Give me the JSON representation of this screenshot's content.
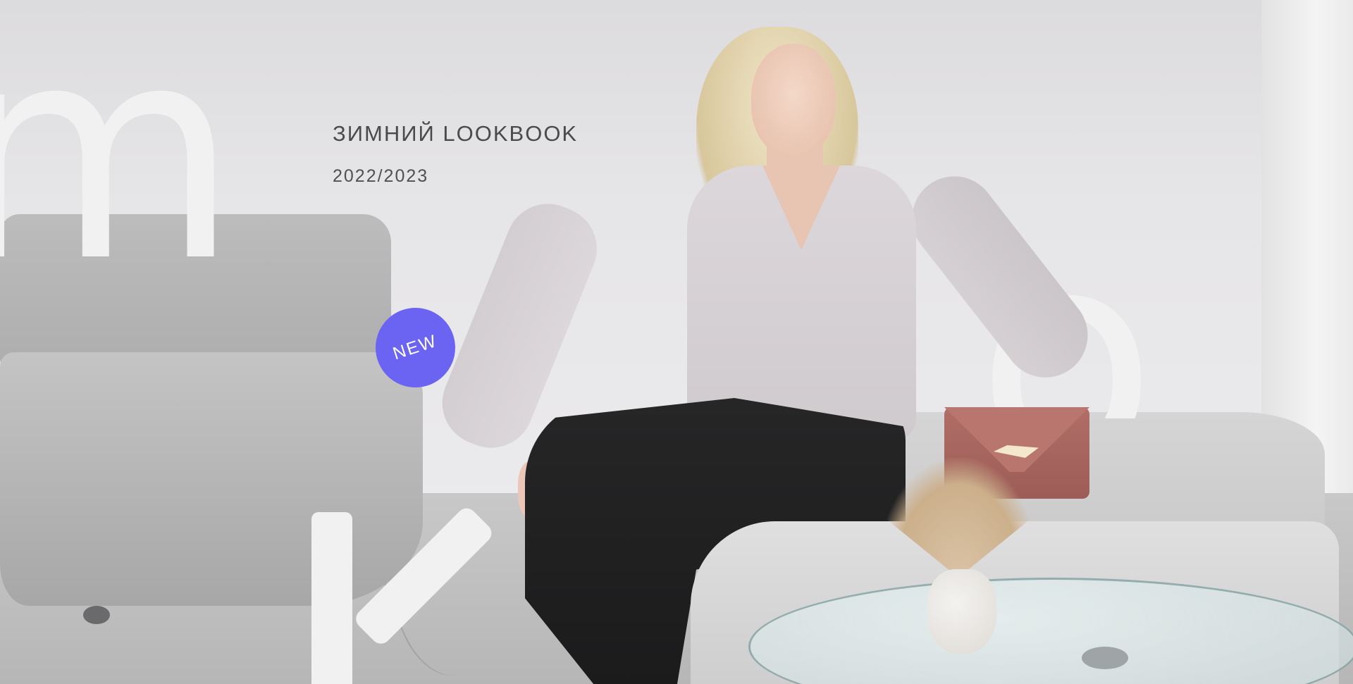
{
  "hero": {
    "title": "ЗИМНИЙ LOOKBOOK",
    "years": "2022/2023",
    "badge_label": "NEW",
    "giant_letters": [
      "m",
      "o",
      "k"
    ],
    "colors": {
      "badge": "#6b63f2",
      "giant_letter": "#f1f1f1",
      "text": "#4a4a4c"
    }
  }
}
